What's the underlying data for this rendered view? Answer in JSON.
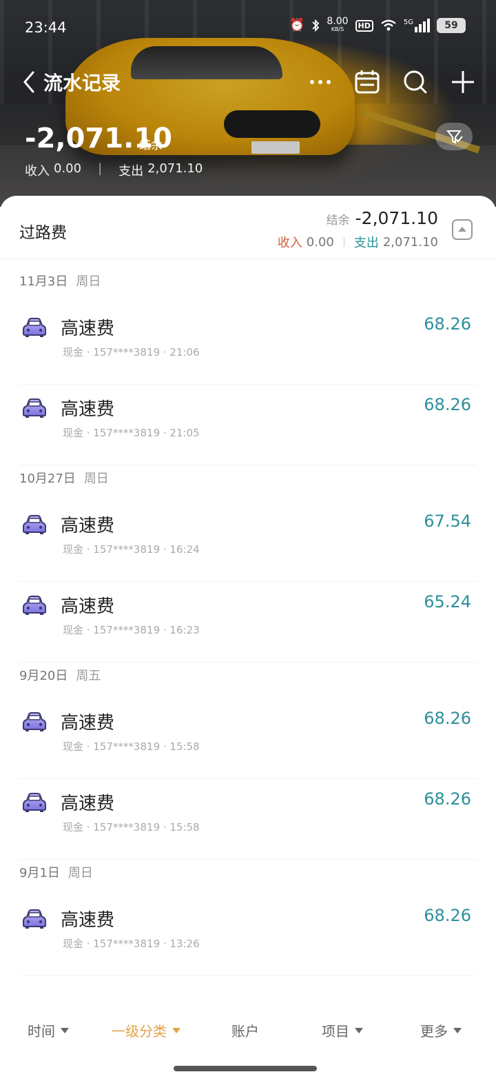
{
  "status": {
    "time": "23:44",
    "net_speed": "8.00",
    "net_unit": "KB/S",
    "hd": "HD",
    "network": "5G",
    "battery": "59"
  },
  "nav": {
    "title": "流水记录"
  },
  "header": {
    "balance": "-2,071.10",
    "balance_label": "结余",
    "income_label": "收入",
    "income": "0.00",
    "expense_label": "支出",
    "expense": "2,071.10"
  },
  "summary": {
    "category": "过路费",
    "balance_label": "结余",
    "balance": "-2,071.10",
    "income_label": "收入",
    "income": "0.00",
    "expense_label": "支出",
    "expense": "2,071.10"
  },
  "groups": [
    {
      "date": "11月3日",
      "weekday": "周日",
      "items": [
        {
          "name": "高速费",
          "meta": "现金 · 157****3819 · 21:06",
          "amount": "68.26"
        },
        {
          "name": "高速费",
          "meta": "现金 · 157****3819 · 21:05",
          "amount": "68.26"
        }
      ]
    },
    {
      "date": "10月27日",
      "weekday": "周日",
      "items": [
        {
          "name": "高速费",
          "meta": "现金 · 157****3819 · 16:24",
          "amount": "67.54"
        },
        {
          "name": "高速费",
          "meta": "现金 · 157****3819 · 16:23",
          "amount": "65.24"
        }
      ]
    },
    {
      "date": "9月20日",
      "weekday": "周五",
      "items": [
        {
          "name": "高速费",
          "meta": "现金 · 157****3819 · 15:58",
          "amount": "68.26"
        },
        {
          "name": "高速费",
          "meta": "现金 · 157****3819 · 15:58",
          "amount": "68.26"
        }
      ]
    },
    {
      "date": "9月1日",
      "weekday": "周日",
      "items": [
        {
          "name": "高速费",
          "meta": "现金 · 157****3819 · 13:26",
          "amount": "68.26"
        }
      ]
    }
  ],
  "tabs": [
    {
      "label": "时间",
      "dropdown": true,
      "active": false
    },
    {
      "label": "一级分类",
      "dropdown": true,
      "active": true
    },
    {
      "label": "账户",
      "dropdown": false,
      "active": false
    },
    {
      "label": "项目",
      "dropdown": true,
      "active": false
    },
    {
      "label": "更多",
      "dropdown": true,
      "active": false
    }
  ],
  "colors": {
    "income": "#d0603b",
    "expense": "#2d8f99",
    "active_tab": "#e3a24a"
  },
  "icons": {
    "back": "chevron-left-icon",
    "more": "more-icon",
    "calendar": "calendar-icon",
    "search": "search-icon",
    "add": "plus-icon",
    "filter": "filter-icon",
    "collapse": "collapse-icon",
    "category": "car-icon"
  }
}
